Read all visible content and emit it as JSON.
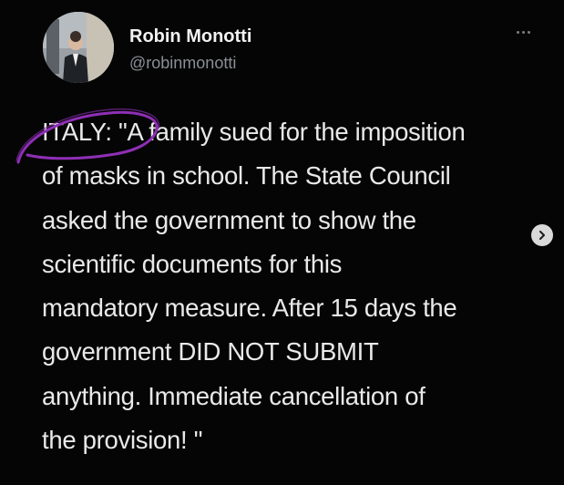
{
  "author": {
    "display_name": "Robin Monotti",
    "handle": "@robinmonotti",
    "avatar_icon": "profile-photo-icon"
  },
  "tweet": {
    "lines": [
      "ITALY: \"A family sued for the imposition",
      "of masks in school. The State Council",
      "asked the government to show the",
      "scientific documents for this",
      "mandatory measure. After 15 days the",
      "government DID NOT SUBMIT",
      "anything. Immediate cancellation of",
      "the provision! \""
    ]
  },
  "icons": {
    "more": "more-dots-icon",
    "next": "chevron-right-icon"
  },
  "colors": {
    "background": "#050505",
    "text": "#e9e9e9",
    "handle": "#8b8f95",
    "annotation": "#8e2fb5"
  }
}
